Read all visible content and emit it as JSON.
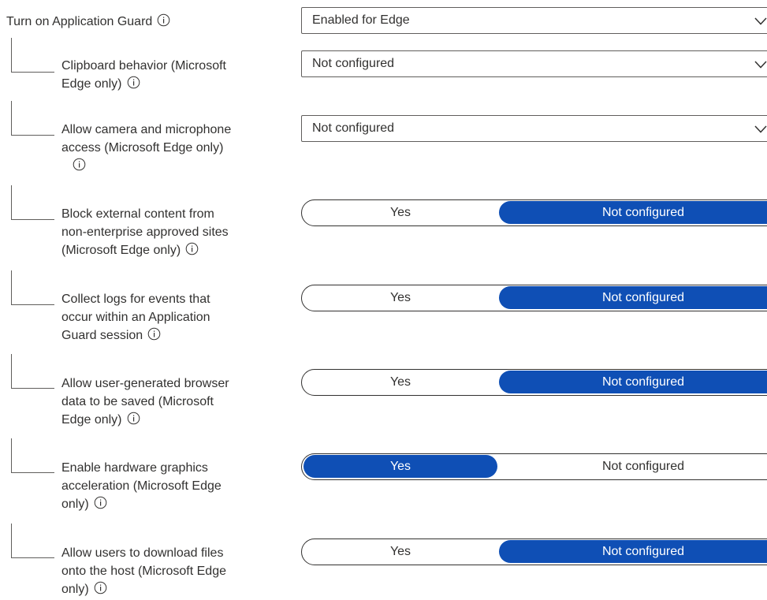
{
  "top": {
    "label": "Turn on Application Guard",
    "value": "Enabled for Edge"
  },
  "settings": [
    {
      "lines": [
        "Clipboard behavior (Microsoft",
        "Edge only)"
      ],
      "type": "dropdown",
      "value": "Not configured"
    },
    {
      "lines": [
        "Allow camera and microphone",
        "access (Microsoft Edge only)",
        ""
      ],
      "type": "dropdown",
      "value": "Not configured"
    },
    {
      "lines": [
        "Block external content from",
        "non-enterprise approved sites",
        "(Microsoft Edge only)"
      ],
      "type": "toggle",
      "yes": "Yes",
      "nc": "Not configured",
      "selected": "nc"
    },
    {
      "lines": [
        "Collect logs for events that",
        "occur within an Application",
        "Guard session"
      ],
      "type": "toggle",
      "yes": "Yes",
      "nc": "Not configured",
      "selected": "nc"
    },
    {
      "lines": [
        "Allow user-generated browser",
        "data to be saved (Microsoft",
        "Edge only)"
      ],
      "type": "toggle",
      "yes": "Yes",
      "nc": "Not configured",
      "selected": "nc"
    },
    {
      "lines": [
        "Enable hardware graphics",
        "acceleration (Microsoft Edge",
        "only)"
      ],
      "type": "toggle",
      "yes": "Yes",
      "nc": "Not configured",
      "selected": "yes"
    },
    {
      "lines": [
        "Allow users to download files",
        "onto the host (Microsoft Edge",
        "only)"
      ],
      "type": "toggle",
      "yes": "Yes",
      "nc": "Not configured",
      "selected": "nc"
    }
  ],
  "colors": {
    "accent": "#0f4fb5",
    "border": "#605e5c",
    "text": "#323130"
  },
  "icons": {
    "info": "info-icon",
    "chevron": "chevron-down-icon"
  }
}
